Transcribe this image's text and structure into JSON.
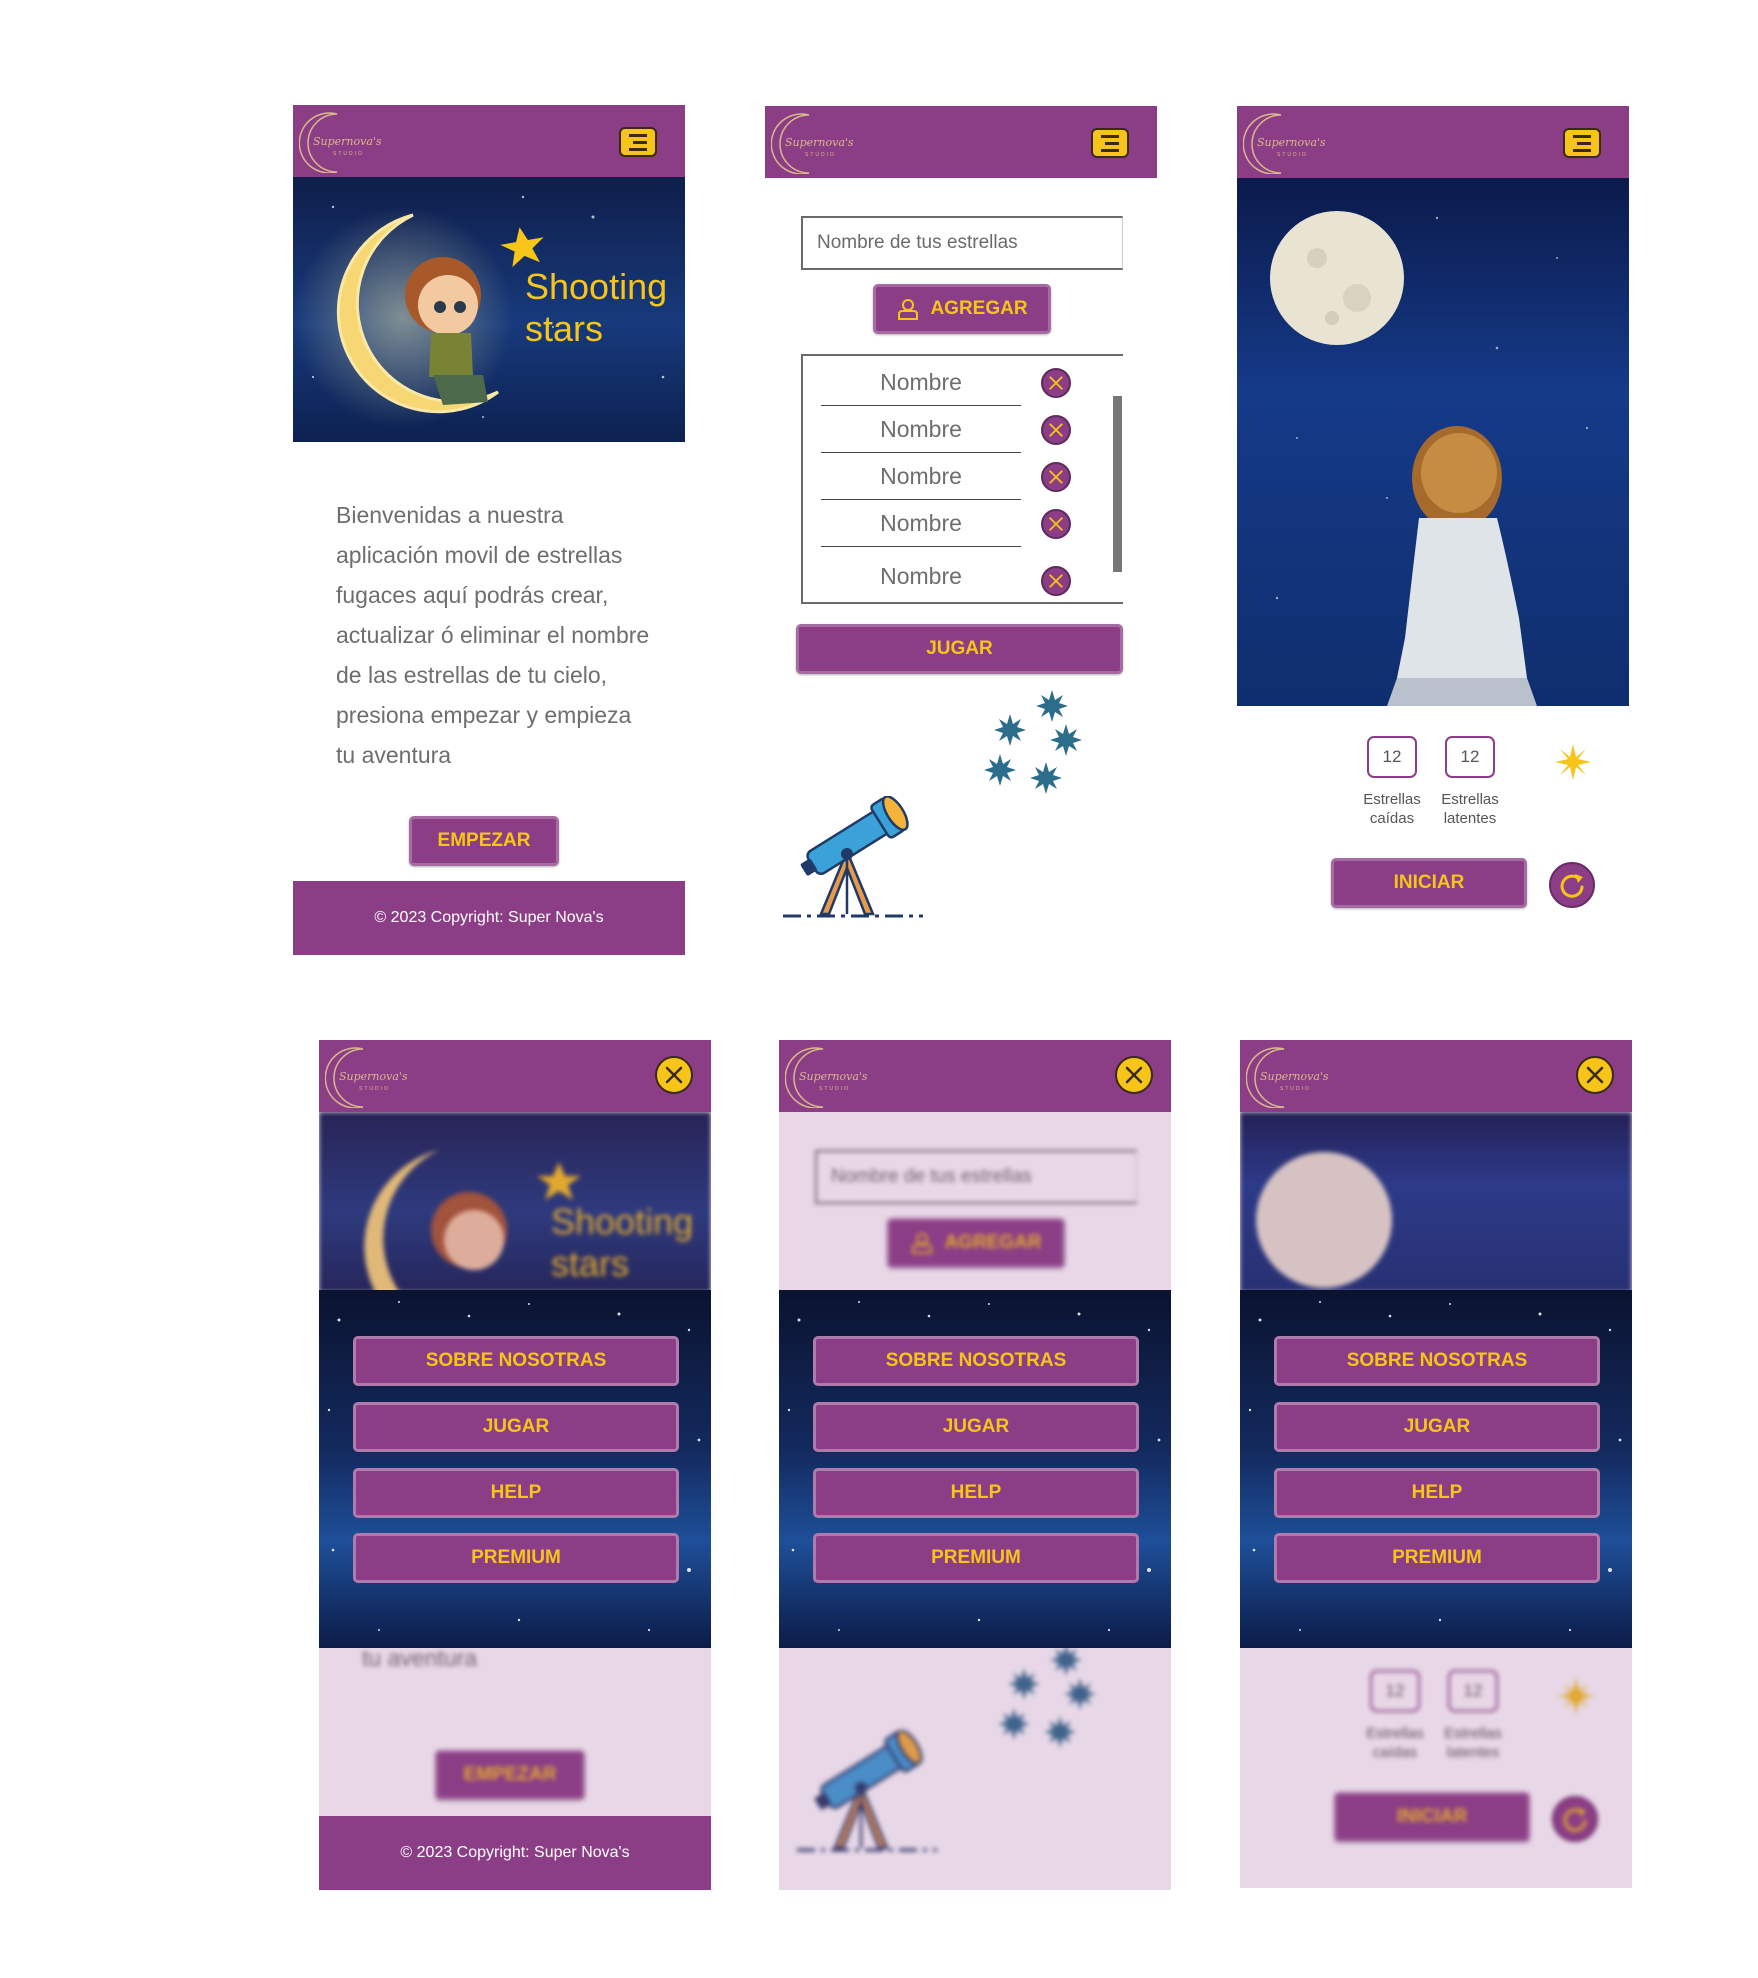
{
  "brand": {
    "logo_text": "Supernova's",
    "logo_sub": "STUDIO"
  },
  "colors": {
    "primary": "#8b3e86",
    "accent": "#f7c419",
    "text": "#6e6e6e",
    "menu_bg": "#0d1f4d"
  },
  "screen_home": {
    "hero_title_line1": "Shooting",
    "hero_title_line2": "stars",
    "welcome_text": "Bienvenidas a nuestra aplicación movil de estrellas fugaces aquí podrás crear, actualizar ó eliminar  el nombre de las estrellas de tu cielo,  presiona empezar y empieza tu aventura",
    "start_button": "EMPEZAR",
    "footer": "© 2023 Copyright: Super Nova's"
  },
  "screen_names": {
    "input_placeholder": "Nombre de tus estrellas",
    "add_button": "AGREGAR",
    "names": [
      "Nombre",
      "Nombre",
      "Nombre",
      "Nombre",
      "Nombre"
    ],
    "play_button": "JUGAR"
  },
  "screen_game": {
    "fallen_count": "12",
    "fallen_label_1": "Estrellas",
    "fallen_label_2": "caídas",
    "latent_count": "12",
    "latent_label_1": "Estrellas",
    "latent_label_2": "latentes",
    "start_button": "INICIAR"
  },
  "menu": {
    "items": [
      "SOBRE NOSOTRAS",
      "JUGAR",
      "HELP",
      "PREMIUM"
    ]
  }
}
